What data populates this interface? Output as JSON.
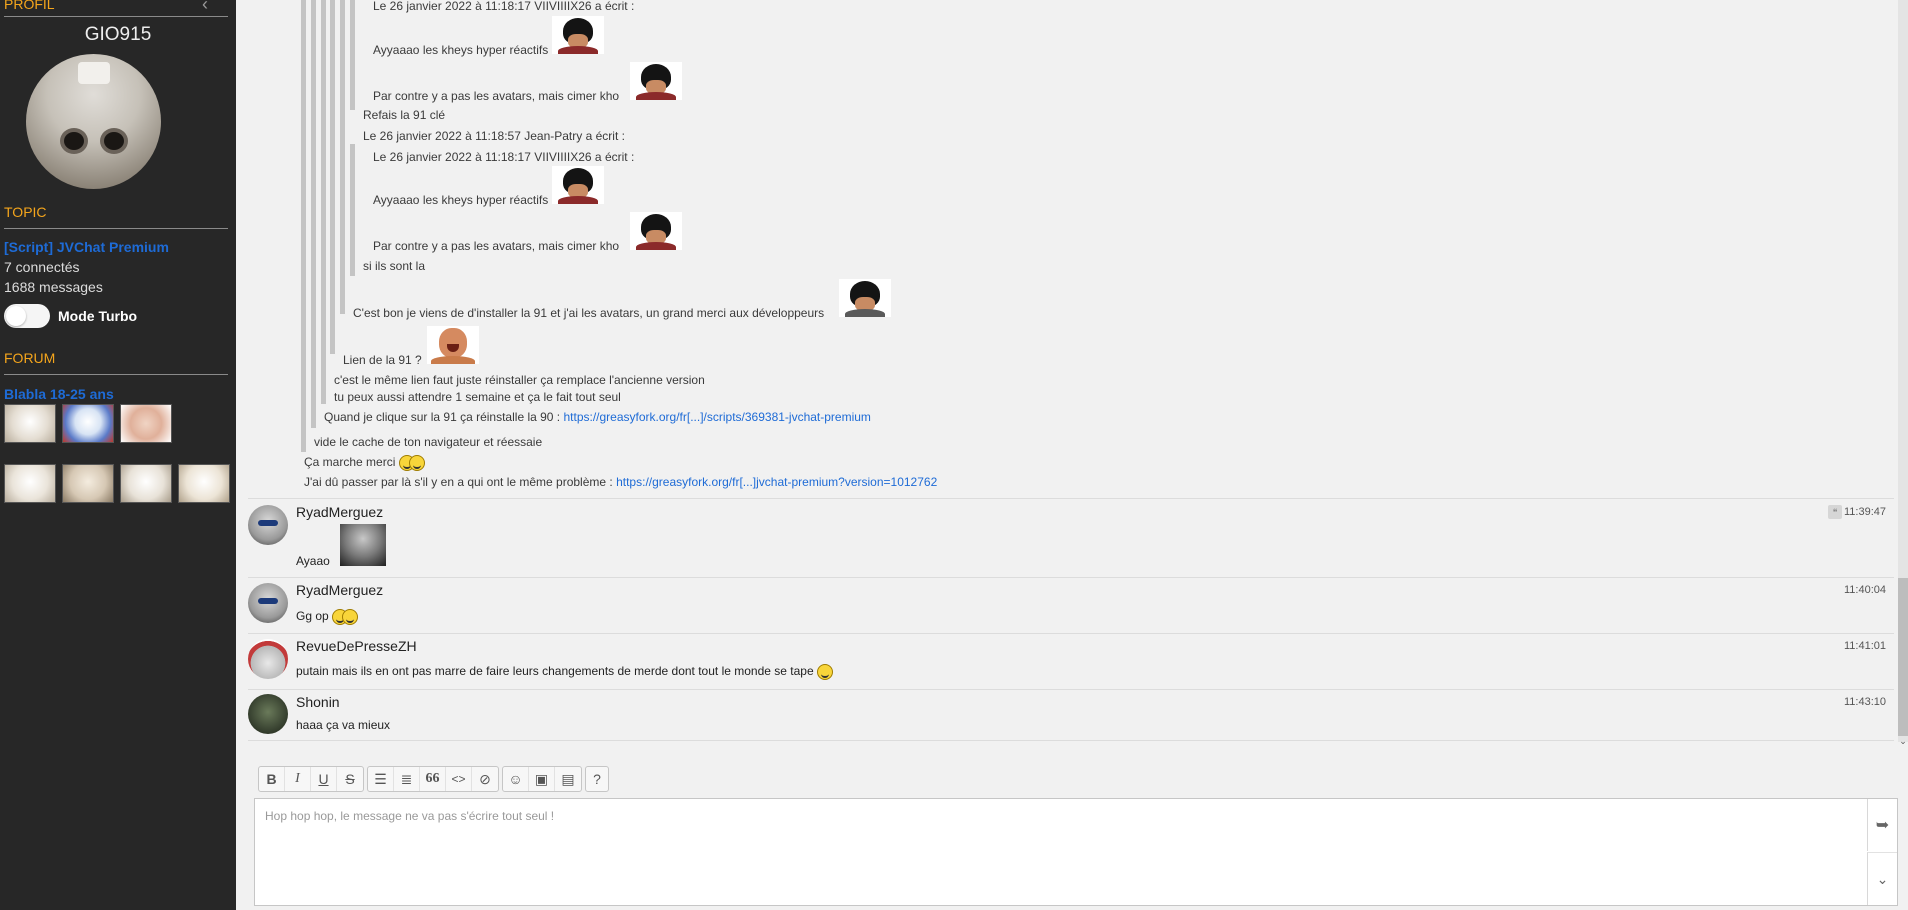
{
  "sidebar": {
    "profile_title": "PROFIL",
    "username": "GIO915",
    "topic_title": "TOPIC",
    "topic_name": "[Script] JVChat Premium",
    "connected": "7 connectés",
    "messages": "1688 messages",
    "turbo_label": "Mode Turbo",
    "forum_title": "FORUM",
    "forum_name": "Blabla 18-25 ans"
  },
  "quotes": {
    "q1_header": "Le 26 janvier 2022 à 11:18:17 VIIVIIIIX26 a écrit :",
    "q1_line1": "Ayyaaao les kheys hyper réactifs",
    "q1_line2": "Par contre y a pas les avatars, mais cimer kho",
    "refais": "Refais la 91 clé",
    "q2_outer_header": "Le 26 janvier 2022 à 11:18:57 Jean-Patry a écrit :",
    "q2_header": "Le 26 janvier 2022 à 11:18:17 VIIVIIIIX26 a écrit :",
    "q2_line1": "Ayyaaao les kheys hyper réactifs",
    "q2_line2": "Par contre y a pas les avatars, mais cimer kho",
    "si_ils": "si ils sont la",
    "cest_bon": "C'est bon je viens de d'installer la 91 et j'ai les avatars, un grand merci aux développeurs",
    "lien": "Lien de la 91 ?",
    "meme_lien": "c'est le même lien faut juste réinstaller ça remplace l'ancienne version",
    "attendre": "tu peux aussi attendre 1 semaine et ça le fait tout seul",
    "quand_text": "Quand je clique sur la 91 ça réinstalle la 90 :",
    "quand_link": "https://greasyfork.org/fr[...]/scripts/369381-jvchat-premium",
    "vide": "vide le cache de ton navigateur et réessaie",
    "ca_marche": "Ça marche merci",
    "jai_du_text": "J'ai dû passer par là s'il y en a qui ont le même problème :",
    "jai_du_link": "https://greasyfork.org/fr[...]jvchat-premium?version=1012762"
  },
  "messages": [
    {
      "author": "RyadMerguez",
      "time": "11:39:47",
      "text": "Ayaao"
    },
    {
      "author": "RyadMerguez",
      "time": "11:40:04",
      "text": "Gg op"
    },
    {
      "author": "RevueDePresseZH",
      "time": "11:41:01",
      "text": "putain mais ils en ont pas marre de faire leurs changements de merde dont tout le monde se tape"
    },
    {
      "author": "Shonin",
      "time": "11:43:10",
      "text": "haaa ça va mieux"
    }
  ],
  "composer": {
    "placeholder": "Hop hop hop, le message ne va pas s'écrire tout seul !",
    "toolbar": {
      "bold": "B",
      "italic": "I",
      "underline": "U",
      "strike": "S",
      "quote": "66",
      "code": "<>",
      "help": "?"
    }
  },
  "icons": [
    "chevron-left-icon",
    "bullet-list-icon",
    "numbered-list-icon",
    "quote-icon",
    "code-icon",
    "spoiler-icon",
    "smiley-icon",
    "image-icon",
    "video-icon",
    "send-icon",
    "expand-icon"
  ],
  "colors": {
    "accent": "#f4a51c",
    "link": "#1e6bd6",
    "sidebar_bg": "#272727"
  }
}
